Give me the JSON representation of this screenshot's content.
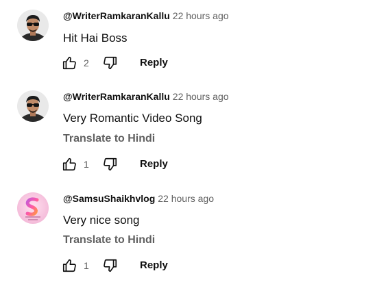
{
  "comments": [
    {
      "author": "@WriterRamkaranKallu",
      "time": "22 hours ago",
      "text": "Hit Hai Boss",
      "likes": "2",
      "reply_label": "Reply",
      "avatar": "man-with-sunglasses-avatar"
    },
    {
      "author": "@WriterRamkaranKallu",
      "time": "22 hours ago",
      "text": "Very Romantic Video Song",
      "translate_label": "Translate to Hindi",
      "likes": "1",
      "reply_label": "Reply",
      "avatar": "man-with-sunglasses-avatar"
    },
    {
      "author": "@SamsuShaikhvlog",
      "time": "22 hours ago",
      "text": "Very nice song",
      "translate_label": "Translate to Hindi",
      "likes": "1",
      "reply_label": "Reply",
      "avatar": "samsu-shaikh-vlog-logo-avatar"
    }
  ],
  "colors": {
    "text_primary": "#0f0f0f",
    "text_secondary": "#606060",
    "background": "#ffffff"
  }
}
